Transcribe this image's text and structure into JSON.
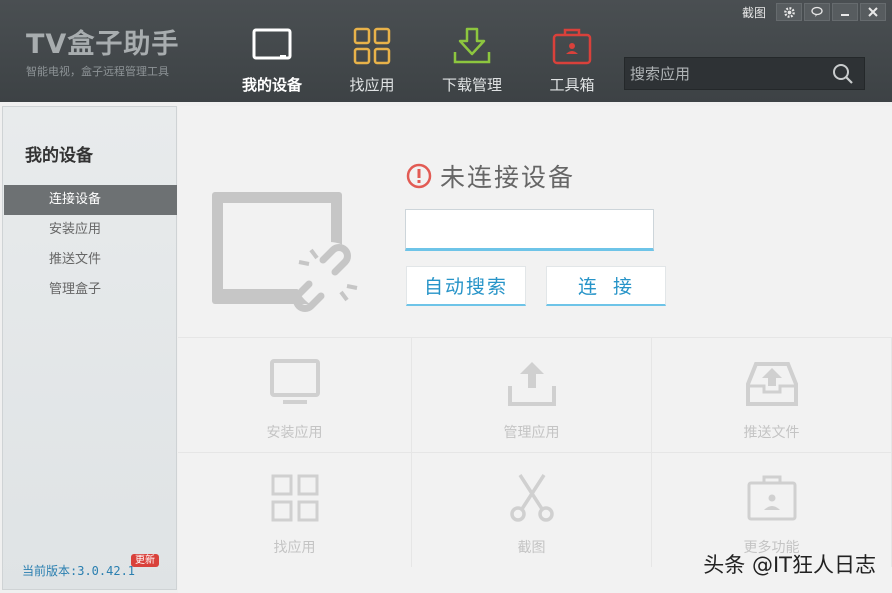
{
  "app": {
    "title": "TV盒子助手",
    "subtitle": "智能电视，盒子远程管理工具"
  },
  "window": {
    "screenshot_label": "截图"
  },
  "nav": [
    {
      "label": "我的设备",
      "icon": "tv-icon",
      "active": true
    },
    {
      "label": "找应用",
      "icon": "grid-icon",
      "active": false
    },
    {
      "label": "下载管理",
      "icon": "download-icon",
      "active": false
    },
    {
      "label": "工具箱",
      "icon": "toolbox-icon",
      "active": false
    }
  ],
  "search": {
    "placeholder": "搜索应用"
  },
  "sidebar": {
    "title": "我的设备",
    "items": [
      {
        "label": "连接设备",
        "active": true
      },
      {
        "label": "安装应用",
        "active": false
      },
      {
        "label": "推送文件",
        "active": false
      },
      {
        "label": "管理盒子",
        "active": false
      }
    ],
    "version": "当前版本:3.0.42.1",
    "update_badge": "更新"
  },
  "main": {
    "status_text": "未连接设备",
    "ip_value": "",
    "auto_search_label": "自动搜索",
    "connect_label": "连接"
  },
  "tiles": [
    {
      "label": "安装应用",
      "icon": "monitor-icon"
    },
    {
      "label": "管理应用",
      "icon": "upload-icon"
    },
    {
      "label": "推送文件",
      "icon": "inbox-upload-icon"
    },
    {
      "label": "找应用",
      "icon": "grid-icon"
    },
    {
      "label": "截图",
      "icon": "scissors-icon"
    },
    {
      "label": "更多功能",
      "icon": "toolbox-icon"
    }
  ],
  "watermark": "头条 @IT狂人日志",
  "colors": {
    "header_bg": "#43484b",
    "accent_blue": "#2794c8",
    "nav_find_app": "#e8b24a",
    "nav_download": "#8dc63f",
    "nav_toolbox": "#d9413b",
    "status_red": "#e25b54"
  }
}
